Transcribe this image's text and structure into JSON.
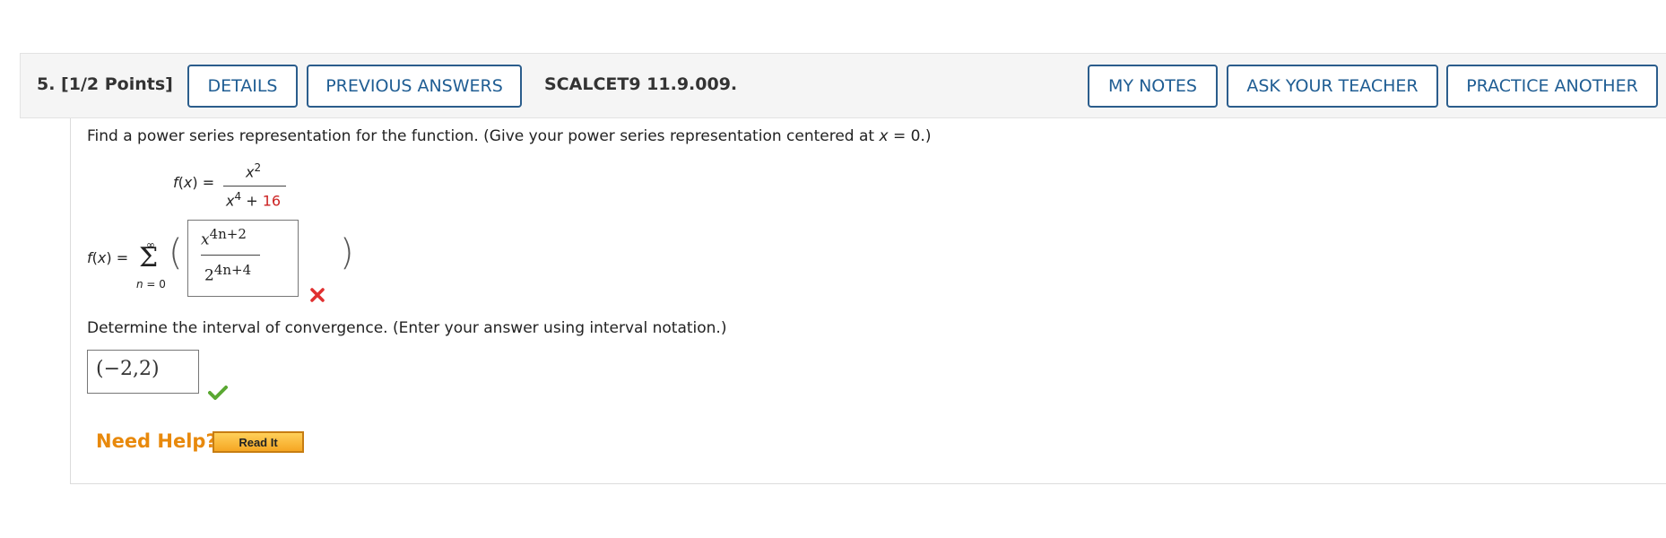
{
  "question": {
    "number_label": "5.  [1/2 Points]",
    "assignment_code": "SCALCET9 11.9.009."
  },
  "header_buttons": {
    "details": "DETAILS",
    "previous_answers": "PREVIOUS ANSWERS",
    "my_notes": "MY NOTES",
    "ask_teacher": "ASK YOUR TEACHER",
    "practice_another": "PRACTICE ANOTHER"
  },
  "prompt1": {
    "text_before": "Find a power series representation for the function. (Give your power series representation centered at ",
    "var": "x",
    "text_after": " = 0.)"
  },
  "function": {
    "lhs": "f(x)",
    "equals": "=",
    "numerator_base": "x",
    "numerator_exp": "2",
    "denominator_base": "x",
    "denominator_exp": "4",
    "denominator_plus": " + ",
    "denominator_const": "16"
  },
  "series": {
    "lhs": "f(x)",
    "equals": "=",
    "sigma": "Σ",
    "upper": "∞",
    "lower": "n = 0",
    "open_paren": "(",
    "close_paren": ")"
  },
  "answer1": {
    "num_base": "x",
    "num_exp": "4n+2",
    "den_base": "2",
    "den_exp": "4n+4",
    "status": "incorrect"
  },
  "prompt2": "Determine the interval of convergence. (Enter your answer using interval notation.)",
  "answer2": {
    "value": "(−2,2)",
    "status": "correct"
  },
  "help": {
    "label": "Need Help?",
    "read_it": "Read It"
  },
  "colors": {
    "button_border": "#2b5d8c",
    "button_text": "#1f5d93",
    "incorrect": "#e03030",
    "correct": "#5aa832",
    "need_help": "#e8890c"
  }
}
